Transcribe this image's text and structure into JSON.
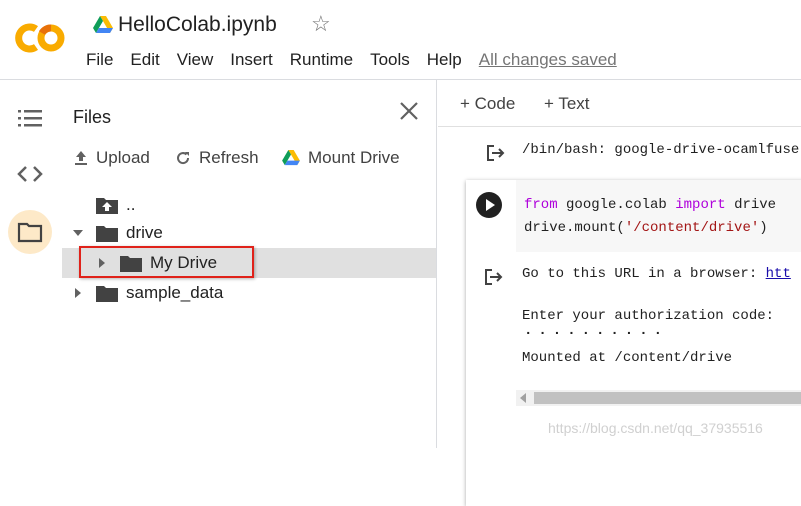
{
  "header": {
    "notebook_title": "HelloColab.ipynb",
    "star_glyph": "☆",
    "menu": [
      "File",
      "Edit",
      "View",
      "Insert",
      "Runtime",
      "Tools",
      "Help"
    ],
    "save_status": "All changes saved"
  },
  "rail": {
    "icons": [
      "table-of-contents-icon",
      "code-snippets-icon",
      "files-icon"
    ],
    "active": "files-icon"
  },
  "files_panel": {
    "title": "Files",
    "actions": {
      "upload": "Upload",
      "refresh": "Refresh",
      "mount": "Mount Drive"
    },
    "tree": {
      "parent": "..",
      "drive": "drive",
      "my_drive": "My Drive",
      "sample_data": "sample_data"
    }
  },
  "notebook": {
    "toolbar": {
      "add_code": "+ Code",
      "add_text": "+ Text"
    },
    "output1": "/bin/bash: google-drive-ocamlfuse",
    "cell": {
      "code": {
        "from_kw": "from",
        "module": "google.colab",
        "import_kw": "import",
        "name": "drive",
        "line2_prefix": "drive.mount(",
        "line2_string": "'/content/drive'",
        "line2_suffix": ")"
      },
      "output": {
        "line1_prefix": "Go to this URL in a browser: ",
        "line1_link": "htt",
        "line2": "Enter your authorization code:",
        "dots": "··········",
        "line3": "Mounted at /content/drive"
      }
    }
  },
  "watermark": "https://blog.csdn.net/qq_37935516",
  "colors": {
    "highlight_border": "#e0221a",
    "active_rail_bg": "#fde9c8",
    "keyword": "#af00db",
    "string": "#a31515",
    "logo_orange": "#f9ab00",
    "logo_dark_orange": "#e8710a"
  }
}
